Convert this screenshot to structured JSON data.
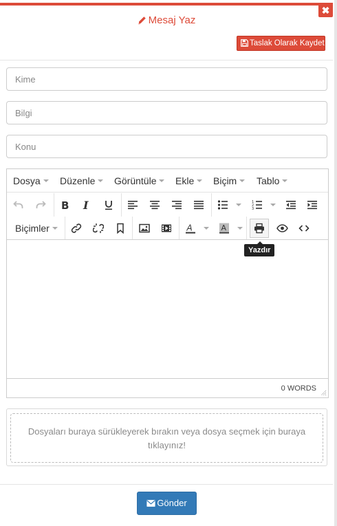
{
  "header": {
    "title": "Mesaj Yaz",
    "draft_button_label": "Taslak Olarak Kaydet",
    "close_label": "✖"
  },
  "fields": {
    "to_placeholder": "Kime",
    "cc_placeholder": "Bilgi",
    "subject_placeholder": "Konu"
  },
  "editor": {
    "menu": [
      "Dosya",
      "Düzenle",
      "Görüntüle",
      "Ekle",
      "Biçim",
      "Tablo"
    ],
    "formats_label": "Biçimler",
    "tooltip": "Yazdır",
    "word_count": "0 WORDS"
  },
  "dropzone": {
    "line1": "Dosyaları buraya sürükleyerek bırakın veya dosya seçmek için buraya",
    "line2": "tıklayınız!"
  },
  "footer": {
    "send_label": "Gönder"
  },
  "colors": {
    "accent_red": "#dd4b39",
    "primary_blue": "#337ab7"
  }
}
